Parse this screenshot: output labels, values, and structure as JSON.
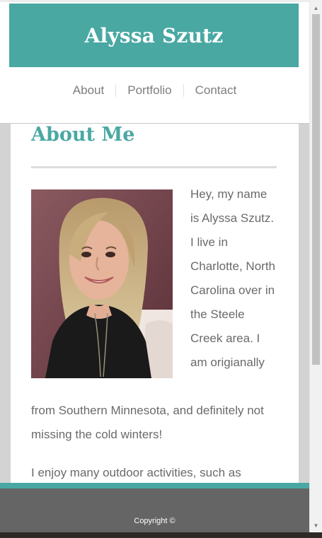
{
  "header": {
    "site_title": "Alyssa Szutz",
    "accent_color": "#4aa8a3"
  },
  "nav": {
    "items": [
      {
        "label": "About"
      },
      {
        "label": "Portfolio"
      },
      {
        "label": "Contact"
      }
    ]
  },
  "main": {
    "heading": "About Me",
    "bio_right": "Hey, my name is Alyssa Szutz. I live in Charlotte, North Carolina over in the Steele Creek area. I am origianally",
    "bio_bottom": "from Southern Minnesota, and definitely not missing the cold winters!",
    "bio_2": "I enjoy many outdoor activities, such as"
  },
  "footer": {
    "copyright": "Copyright ©"
  },
  "icons": {
    "scroll_up": "triangle-up-icon",
    "scroll_down": "triangle-down-icon"
  }
}
